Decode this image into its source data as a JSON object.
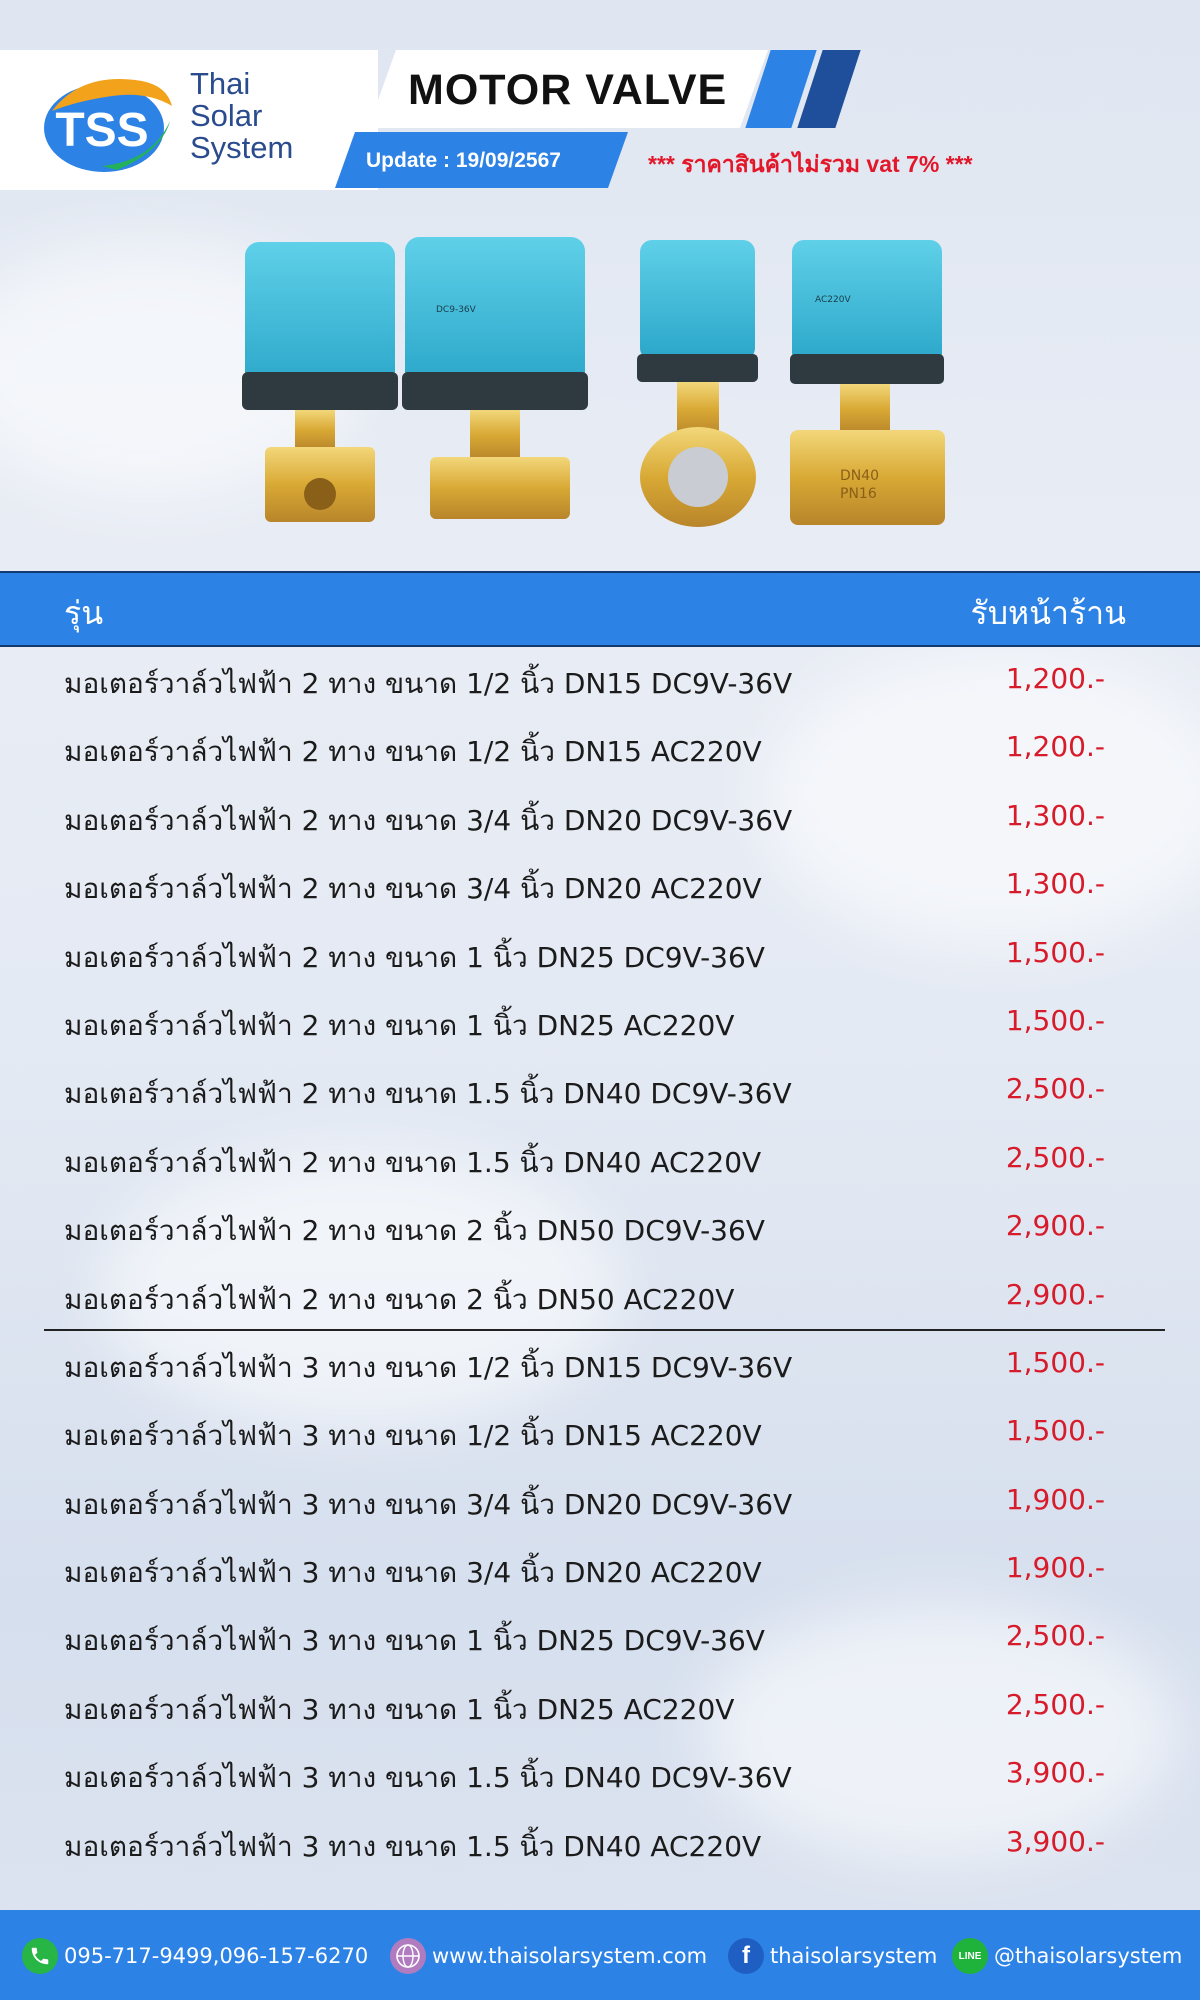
{
  "header": {
    "brand_line1": "Thai",
    "brand_line2": "Solar",
    "brand_line3": "System",
    "logo_letters": "TSS",
    "title": "MOTOR VALVE",
    "update": "Update : 19/09/2567",
    "vat_note": "*** ราคาสินค้าไม่รวม vat 7% ***"
  },
  "table": {
    "col_model": "รุ่น",
    "col_price": "รับหน้าร้าน",
    "rows": [
      {
        "name": "มอเตอร์วาล์วไฟฟ้า 2 ทาง ขนาด 1/2 นิ้ว DN15 DC9V-36V",
        "price": "1,200.-"
      },
      {
        "name": "มอเตอร์วาล์วไฟฟ้า 2 ทาง ขนาด 1/2 นิ้ว DN15 AC220V",
        "price": "1,200.-"
      },
      {
        "name": "มอเตอร์วาล์วไฟฟ้า 2 ทาง ขนาด 3/4 นิ้ว DN20 DC9V-36V",
        "price": "1,300.-"
      },
      {
        "name": "มอเตอร์วาล์วไฟฟ้า 2 ทาง ขนาด 3/4 นิ้ว DN20 AC220V",
        "price": "1,300.-"
      },
      {
        "name": "มอเตอร์วาล์วไฟฟ้า 2 ทาง ขนาด 1 นิ้ว DN25 DC9V-36V",
        "price": "1,500.-"
      },
      {
        "name": "มอเตอร์วาล์วไฟฟ้า 2 ทาง ขนาด 1 นิ้ว DN25 AC220V",
        "price": "1,500.-"
      },
      {
        "name": "มอเตอร์วาล์วไฟฟ้า 2 ทาง ขนาด 1.5 นิ้ว DN40 DC9V-36V",
        "price": "2,500.-"
      },
      {
        "name": "มอเตอร์วาล์วไฟฟ้า 2 ทาง ขนาด 1.5 นิ้ว DN40 AC220V",
        "price": "2,500.-"
      },
      {
        "name": "มอเตอร์วาล์วไฟฟ้า 2 ทาง ขนาด 2 นิ้ว DN50 DC9V-36V",
        "price": "2,900.-"
      },
      {
        "name": "มอเตอร์วาล์วไฟฟ้า 2 ทาง ขนาด 2 นิ้ว DN50 AC220V",
        "price": "2,900.-"
      },
      {
        "name": "มอเตอร์วาล์วไฟฟ้า 3 ทาง ขนาด 1/2 นิ้ว DN15 DC9V-36V",
        "price": "1,500.-"
      },
      {
        "name": "มอเตอร์วาล์วไฟฟ้า 3 ทาง ขนาด 1/2 นิ้ว DN15 AC220V",
        "price": "1,500.-"
      },
      {
        "name": "มอเตอร์วาล์วไฟฟ้า 3 ทาง ขนาด 3/4 นิ้ว DN20 DC9V-36V",
        "price": "1,900.-"
      },
      {
        "name": "มอเตอร์วาล์วไฟฟ้า 3 ทาง ขนาด 3/4 นิ้ว DN20 AC220V",
        "price": "1,900.-"
      },
      {
        "name": "มอเตอร์วาล์วไฟฟ้า 3 ทาง ขนาด 1 นิ้ว DN25 DC9V-36V",
        "price": "2,500.-"
      },
      {
        "name": "มอเตอร์วาล์วไฟฟ้า 3 ทาง ขนาด 1 นิ้ว DN25 AC220V",
        "price": "2,500.-"
      },
      {
        "name": "มอเตอร์วาล์วไฟฟ้า 3 ทาง ขนาด 1.5 นิ้ว DN40 DC9V-36V",
        "price": "3,900.-"
      },
      {
        "name": "มอเตอร์วาล์วไฟฟ้า 3 ทาง ขนาด 1.5 นิ้ว DN40 AC220V",
        "price": "3,900.-"
      }
    ]
  },
  "footer": {
    "phone": "095-717-9499,096-157-6270",
    "website": "www.thaisolarsystem.com",
    "facebook": "thaisolarsystem",
    "line": "@thaisolarsystem",
    "line_badge": "LINE",
    "fb_badge": "f"
  },
  "product_labels": {
    "v1": "DC9-36V",
    "v2": "AC220V",
    "size1": "DN40",
    "size2": "PN16"
  },
  "colors": {
    "accent": "#2d82e6",
    "navy": "#1f4e9a",
    "price_red": "#d81b2a",
    "vat_red": "#e3172a"
  }
}
